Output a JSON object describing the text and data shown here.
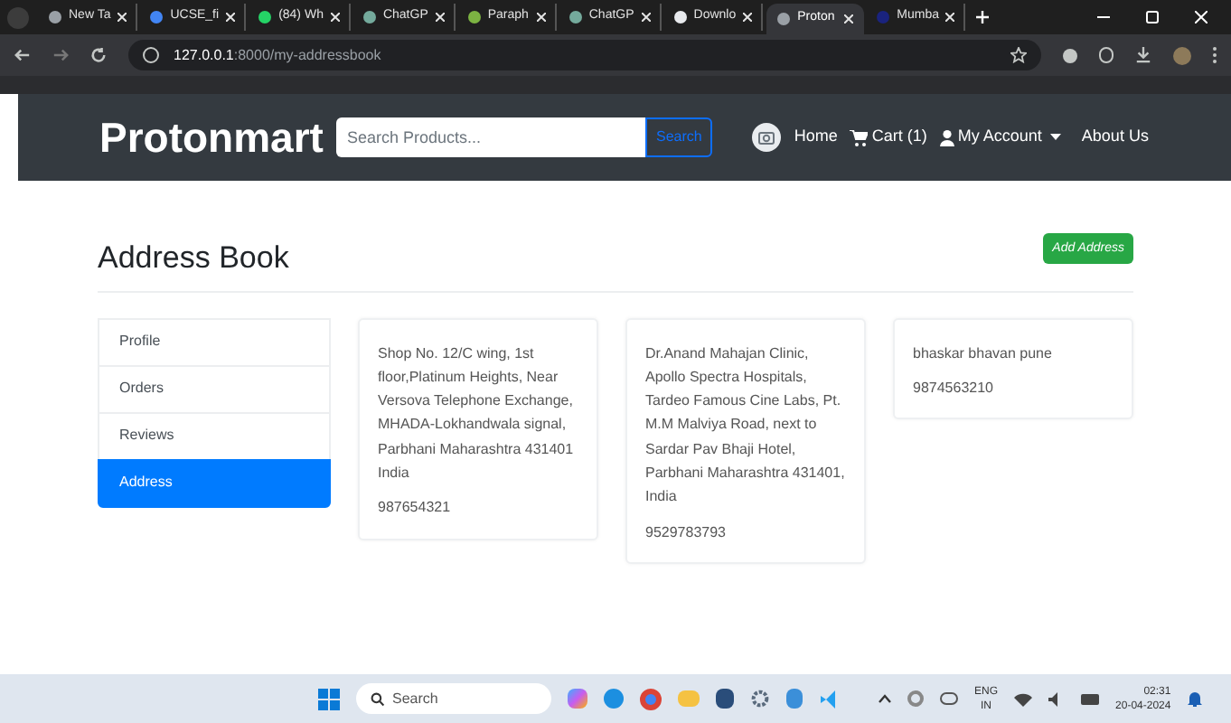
{
  "browser": {
    "tabs": [
      {
        "title": "New Ta",
        "selected": false,
        "color": "#9aa0a6"
      },
      {
        "title": "UCSE_fi",
        "selected": false,
        "color": "#4285f4"
      },
      {
        "title": "(84) Wh",
        "selected": false,
        "color": "#25d366"
      },
      {
        "title": "ChatGP",
        "selected": false,
        "color": "#74aa9c"
      },
      {
        "title": "Paraph",
        "selected": false,
        "color": "#7cb342"
      },
      {
        "title": "ChatGP",
        "selected": false,
        "color": "#74aa9c"
      },
      {
        "title": "Downlo",
        "selected": false,
        "color": "#e8eaed"
      },
      {
        "title": "Proton",
        "selected": true,
        "color": "#9aa0a6"
      },
      {
        "title": "Mumba",
        "selected": false,
        "color": "#1a237e"
      }
    ],
    "url": {
      "host": "127.0.0.1",
      "path": ":8000/my-addressbook"
    }
  },
  "navbar": {
    "brand": "Protonmart",
    "search": {
      "placeholder": "Search Products...",
      "button": "Search"
    },
    "links": [
      {
        "kind": "home",
        "label": "Home"
      },
      {
        "kind": "cart",
        "label": "Cart (1)"
      },
      {
        "kind": "account",
        "label": "My Account"
      },
      {
        "kind": "plain",
        "label": "About Us"
      }
    ]
  },
  "page": {
    "title": "Address Book",
    "add_button": "Add Address",
    "sidebar": [
      {
        "label": "Profile",
        "selected": false
      },
      {
        "label": "Orders",
        "selected": false
      },
      {
        "label": "Reviews",
        "selected": false
      },
      {
        "label": "Address",
        "selected": true
      }
    ],
    "addresses": [
      {
        "address": "Shop No. 12/C wing, 1st floor,Platinum Heights, Near Versova Telephone Exchange, MHADA-Lokhandwala signal, Parbhani Maharashtra 431401 India",
        "phone": "987654321"
      },
      {
        "address": "Dr.Anand Mahajan Clinic, Apollo Spectra Hospitals, Tardeo Famous Cine Labs, Pt. M.M Malviya Road, next to Sardar Pav Bhaji Hotel, Parbhani Maharashtra 431401, India",
        "phone": "9529783793"
      },
      {
        "address": "bhaskar bhavan pune",
        "phone": "9874563210"
      }
    ]
  },
  "taskbar": {
    "search": "Search",
    "language": "ENG",
    "region": "IN",
    "time": "02:31",
    "date": "20-04-2024"
  }
}
